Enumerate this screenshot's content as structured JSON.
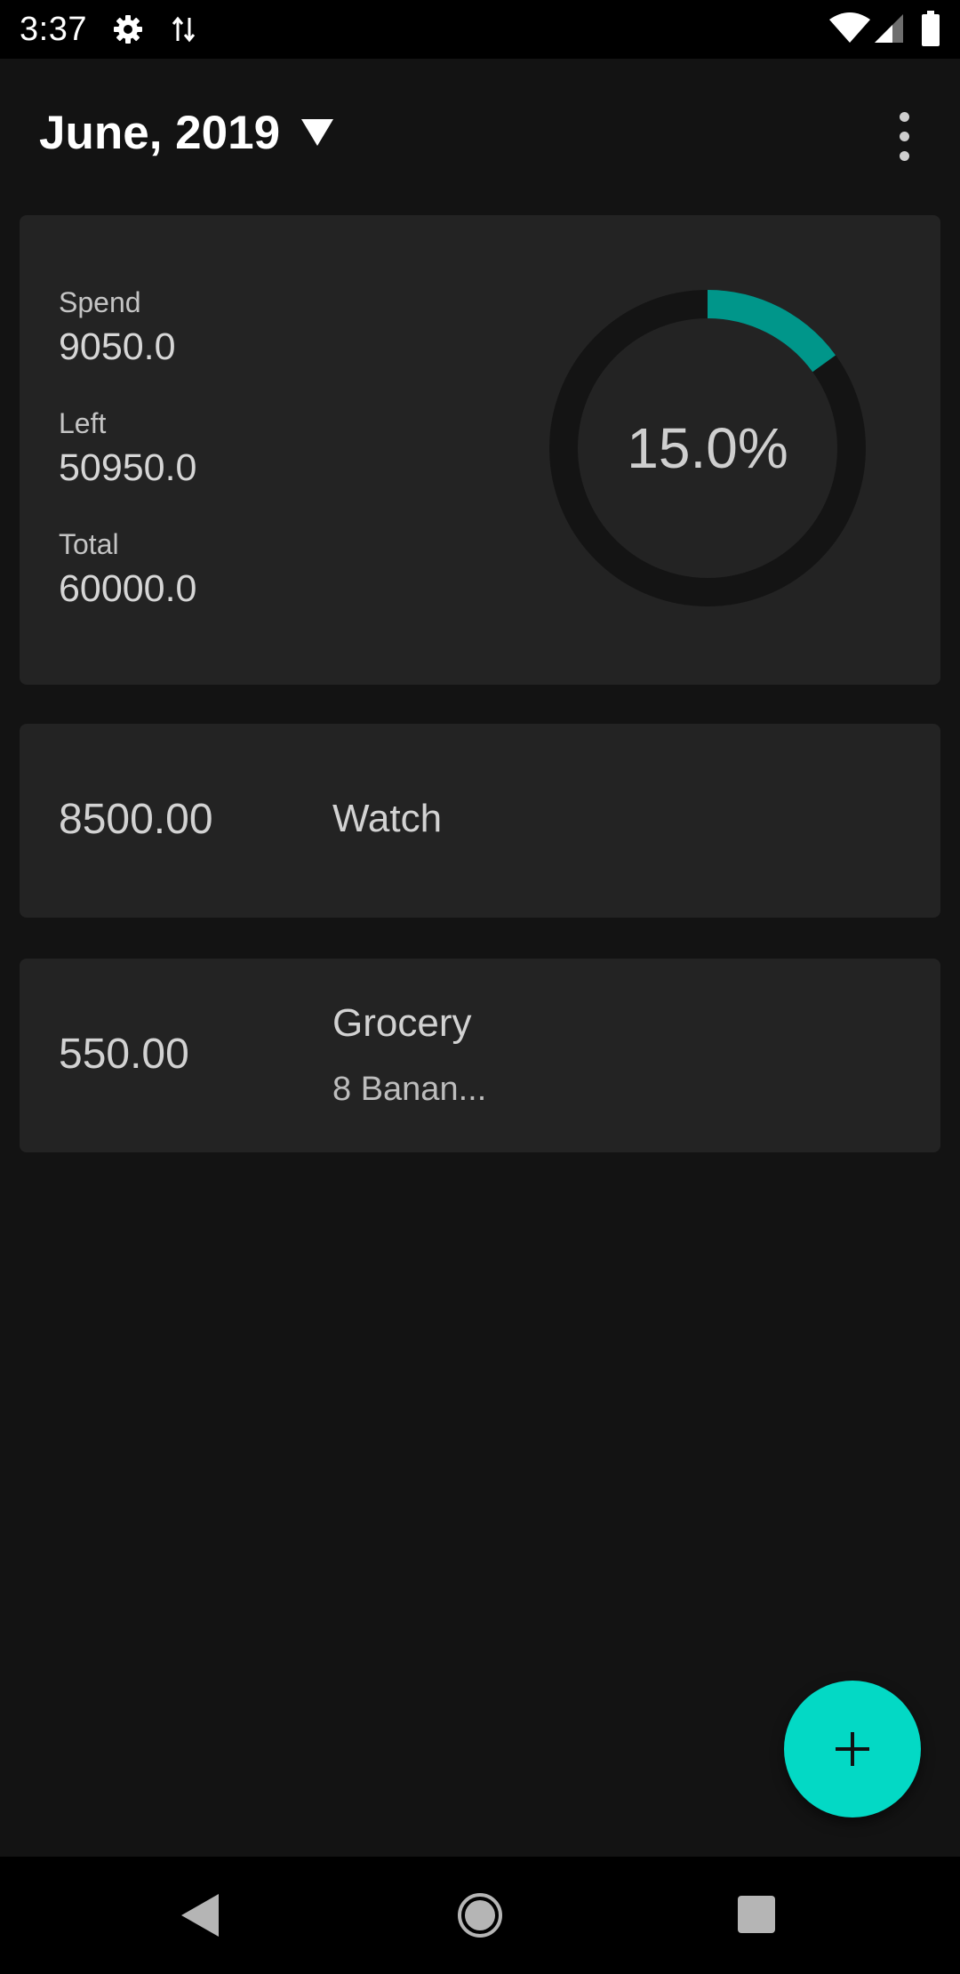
{
  "status_bar": {
    "time": "3:37",
    "icons": [
      "settings-icon",
      "data-transfer-icon",
      "wifi-icon",
      "signal-icon",
      "battery-icon"
    ]
  },
  "header": {
    "month": "June, 2019",
    "menu_icon": "more-vert-icon"
  },
  "summary": {
    "spend_label": "Spend",
    "spend_value": "9050.0",
    "left_label": "Left",
    "left_value": "50950.0",
    "total_label": "Total",
    "total_value": "60000.0",
    "progress_text": "15.0%",
    "progress_fraction": 0.15
  },
  "expenses": [
    {
      "amount": "8500.00",
      "title": "Watch"
    },
    {
      "amount": "550.00",
      "title": "Grocery",
      "note": "8 Banan..."
    }
  ],
  "fab": {
    "icon": "add-icon"
  },
  "nav_bar": {
    "icons": [
      "back-icon",
      "home-icon",
      "recents-icon"
    ]
  },
  "colors": {
    "background": "#131313",
    "card": "#232323",
    "accent": "#03d9c5",
    "progress_fill": "#00968a",
    "progress_track": "#141414"
  }
}
